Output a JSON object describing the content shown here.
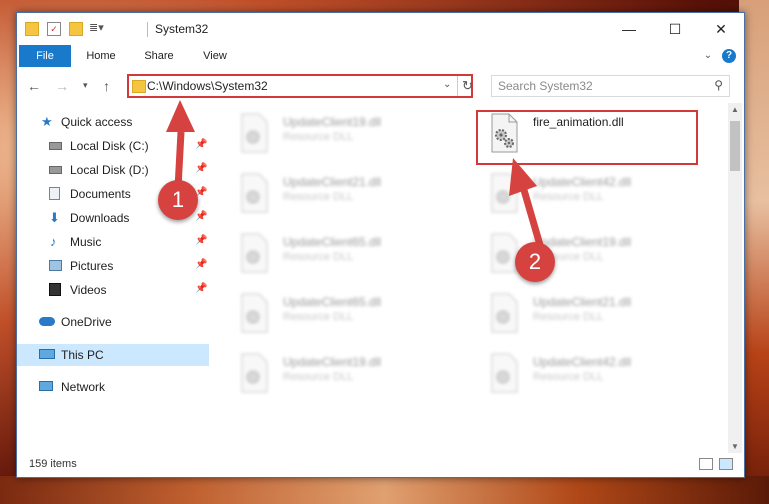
{
  "window": {
    "title": "System32",
    "minimize_icon": "minimize-icon",
    "maximize_icon": "maximize-icon",
    "close_icon": "close-icon"
  },
  "ribbon": {
    "tabs": [
      "File",
      "Home",
      "Share",
      "View"
    ]
  },
  "address": {
    "path": "C:\\Windows\\System32",
    "refresh_icon": "refresh-icon"
  },
  "search": {
    "placeholder": "Search System32"
  },
  "sidebar": {
    "items": [
      {
        "label": "Quick access",
        "icon": "star-icon",
        "pinned": false
      },
      {
        "label": "Local Disk (C:)",
        "icon": "drive-icon",
        "pinned": true
      },
      {
        "label": "Local Disk (D:)",
        "icon": "drive-icon",
        "pinned": true
      },
      {
        "label": "Documents",
        "icon": "documents-icon",
        "pinned": true
      },
      {
        "label": "Downloads",
        "icon": "download-icon",
        "pinned": true
      },
      {
        "label": "Music",
        "icon": "music-icon",
        "pinned": true
      },
      {
        "label": "Pictures",
        "icon": "pictures-icon",
        "pinned": true
      },
      {
        "label": "Videos",
        "icon": "videos-icon",
        "pinned": true
      },
      {
        "label": "OneDrive",
        "icon": "cloud-icon",
        "pinned": false
      },
      {
        "label": "This PC",
        "icon": "computer-icon",
        "pinned": false,
        "selected": true
      },
      {
        "label": "Network",
        "icon": "network-icon",
        "pinned": false
      }
    ]
  },
  "files": [
    {
      "name": "UpdateClient19.dll",
      "type": "Resource DLL"
    },
    {
      "name": "fire_animation.dll",
      "type": ""
    },
    {
      "name": "UpdateClient21.dll",
      "type": "Resource DLL"
    },
    {
      "name": "UpdateClient42.dll",
      "type": "Resource DLL"
    },
    {
      "name": "UpdateClient65.dll",
      "type": "Resource DLL"
    },
    {
      "name": "UpdateClient19.dll",
      "type": "Resource DLL"
    },
    {
      "name": "UpdateClient65.dll",
      "type": "Resource DLL"
    },
    {
      "name": "UpdateClient21.dll",
      "type": "Resource DLL"
    },
    {
      "name": "UpdateClient19.dll",
      "type": "Resource DLL"
    },
    {
      "name": "UpdateClient42.dll",
      "type": "Resource DLL"
    }
  ],
  "status": {
    "item_count": "159 items"
  },
  "annotations": {
    "step1": "1",
    "step2": "2",
    "accent": "#d23a3a"
  }
}
